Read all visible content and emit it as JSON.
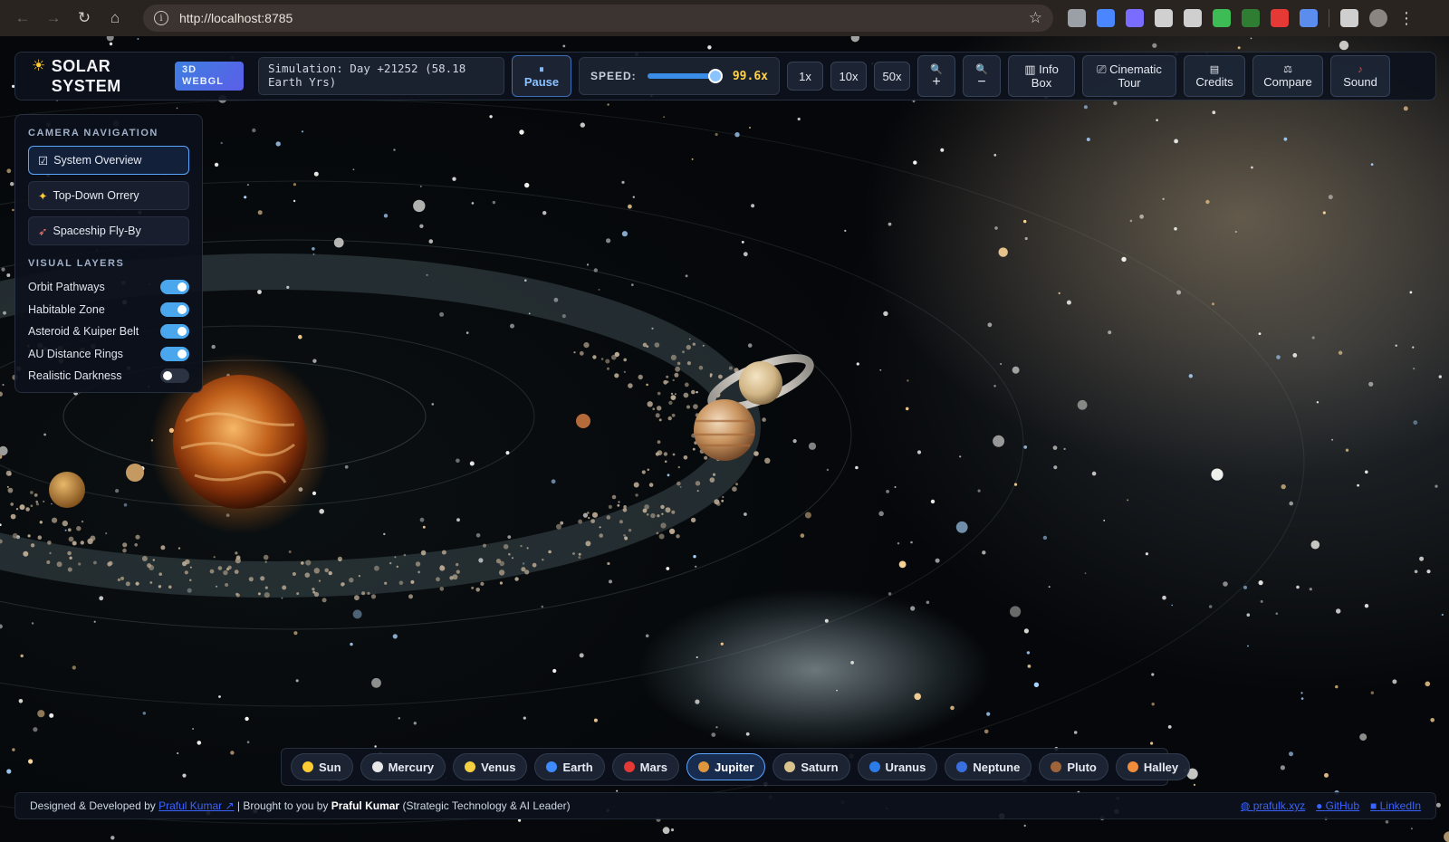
{
  "browser": {
    "url": "http://localhost:8785",
    "extension_colors": [
      "#9aa0a6",
      "#4a86ff",
      "#7a6cff",
      "#d0d0d0",
      "#cfcfcf",
      "#3dbb55",
      "#2e7d32",
      "#e53935",
      "#5b8def",
      "#cfcfcf"
    ]
  },
  "app": {
    "title_line1": "SOLAR",
    "title_line2": "SYSTEM",
    "badge": "3D WEBGL",
    "simulation_text": "Simulation: Day +21252 (58.18 Earth Yrs)",
    "pause_label": "Pause",
    "speed_label": "SPEED:",
    "speed_value": "99.6x",
    "speed_fraction": 0.92,
    "speed_presets": [
      "1x",
      "10x",
      "50x"
    ],
    "zoom_in": "+",
    "zoom_out": "−",
    "actions": [
      {
        "line1": "Info",
        "line2": "Box"
      },
      {
        "line1": "Cinematic",
        "line2": "Tour"
      },
      {
        "line1": "Credits",
        "line2": ""
      },
      {
        "line1": "Compare",
        "line2": ""
      },
      {
        "line1": "Sound",
        "line2": ""
      }
    ]
  },
  "panel": {
    "camera_heading": "CAMERA NAVIGATION",
    "camera_modes": [
      "System Overview",
      "Top-Down Orrery",
      "Spaceship Fly-By"
    ],
    "layers_heading": "VISUAL LAYERS",
    "layers": [
      {
        "label": "Orbit Pathways",
        "on": true
      },
      {
        "label": "Habitable Zone",
        "on": true
      },
      {
        "label": "Asteroid & Kuiper Belt",
        "on": true
      },
      {
        "label": "AU Distance Rings",
        "on": true
      },
      {
        "label": "Realistic Darkness",
        "on": false
      }
    ]
  },
  "planets": [
    {
      "name": "Sun",
      "color": "#ffcc33"
    },
    {
      "name": "Mercury",
      "color": "#e8e8e8"
    },
    {
      "name": "Venus",
      "color": "#f5d142"
    },
    {
      "name": "Earth",
      "color": "#3d8bff"
    },
    {
      "name": "Mars",
      "color": "#e53935"
    },
    {
      "name": "Jupiter",
      "color": "#e0963c"
    },
    {
      "name": "Saturn",
      "color": "#d9c38c"
    },
    {
      "name": "Uranus",
      "color": "#2b7be8"
    },
    {
      "name": "Neptune",
      "color": "#3a6fe0"
    },
    {
      "name": "Pluto",
      "color": "#a0643a"
    },
    {
      "name": "Halley",
      "color": "#f08c3c"
    }
  ],
  "footer": {
    "designed_prefix": "Designed & Developed by",
    "designed_link": "Praful Kumar ↗",
    "separator": "|",
    "brought_prefix": "Brought to you by",
    "brought_name": "Praful Kumar",
    "brought_suffix": "(Strategic Technology & AI Leader)",
    "right_links": [
      "prafulk.xyz",
      "GitHub",
      "LinkedIn"
    ]
  }
}
